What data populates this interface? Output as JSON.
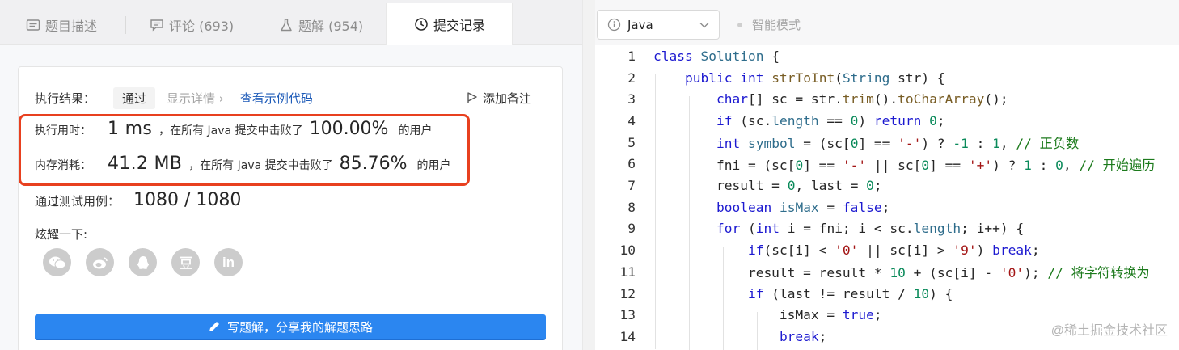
{
  "tabs": [
    {
      "label": "题目描述",
      "icon": "description-icon"
    },
    {
      "label": "评论 (693)",
      "icon": "comment-icon"
    },
    {
      "label": "题解 (954)",
      "icon": "flask-icon"
    },
    {
      "label": "提交记录",
      "icon": "clock-icon"
    }
  ],
  "result": {
    "label": "执行结果：",
    "status": "通过",
    "details": "显示详情 ›",
    "example": "查看示例代码",
    "note": "添加备注"
  },
  "runtime": {
    "label": "执行用时：",
    "value": "1 ms",
    "middle": "，在所有 Java 提交中击败了",
    "percent": "100.00%",
    "tail": "的用户"
  },
  "memory": {
    "label": "内存消耗：",
    "value": "41.2 MB",
    "middle": "，在所有 Java 提交中击败了",
    "percent": "85.76%",
    "tail": "的用户"
  },
  "tests": {
    "label": "通过测试用例：",
    "value": "1080 / 1080"
  },
  "share": {
    "label": "炫耀一下:",
    "icons": [
      "wechat-icon",
      "weibo-icon",
      "qq-icon",
      "douban-icon",
      "linkedin-icon"
    ]
  },
  "write_button": "写题解，分享我的解题思路",
  "editor": {
    "language": "Java",
    "smart_mode": "智能模式",
    "watermark": "@稀土掘金技术社区",
    "line_numbers": [
      "1",
      "2",
      "3",
      "4",
      "5",
      "6",
      "7",
      "8",
      "9",
      "10",
      "11",
      "12",
      "13",
      "14"
    ]
  },
  "colors": {
    "highlight": "#e8401f",
    "button": "#2b86f0",
    "keyword": "#1d1ad0"
  }
}
